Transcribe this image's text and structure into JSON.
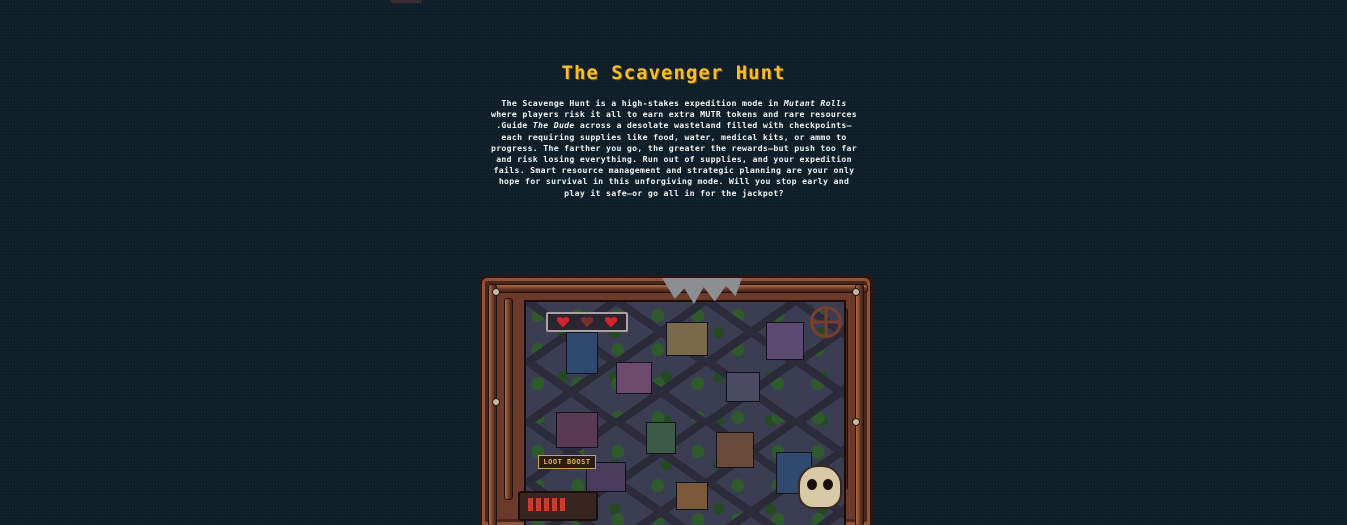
{
  "page": {
    "title": "The Scavenger Hunt",
    "description_parts": [
      "The Scavenge Hunt is a high-stakes expedition mode in ",
      "Mutant Rolls",
      " where players risk it all to earn extra MUTR tokens and rare resources .Guide ",
      "The Dude",
      " across a desolate wasteland filled with checkpoints—each requiring supplies like food, water, medical kits, or ammo to progress. The farther you go, the greater the rewards—but push too far and risk losing everything. Run out of supplies, and your expedition fails. Smart resource management and strategic planning are your only hope for survival in this unforgiving mode. Will you stop early and play it safe—or go all in for the jackpot?"
    ]
  },
  "game_image": {
    "loot_label": "LOOT BOOST",
    "hud_icons": [
      "heart-icon",
      "heart-icon",
      "heart-icon"
    ],
    "colors": {
      "title": "#f4bf2c",
      "background": "#0f1f29",
      "frame": "#6b3a2a"
    }
  }
}
